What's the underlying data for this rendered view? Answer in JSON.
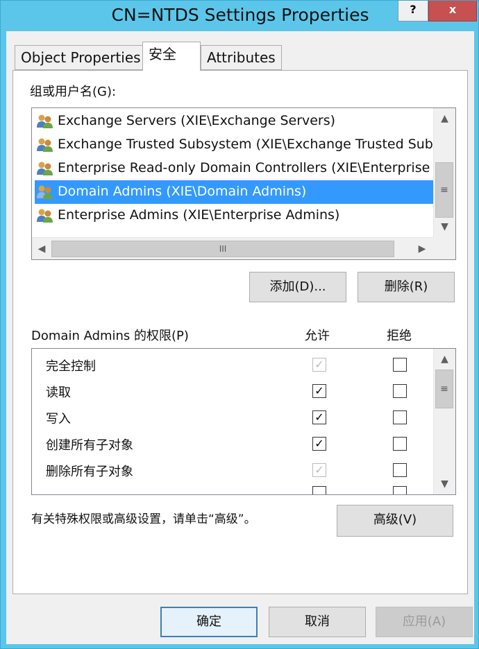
{
  "window": {
    "title": "CN=NTDS Settings Properties",
    "help_label": "?",
    "close_label": "x"
  },
  "tabs": [
    {
      "label": "Object Properties",
      "active": false
    },
    {
      "label": "安全",
      "active": true
    },
    {
      "label": "Attributes",
      "active": false
    }
  ],
  "security": {
    "group_label": "组或用户名(G):",
    "groups": [
      {
        "name": "Exchange Servers (XIE\\Exchange Servers)",
        "selected": false
      },
      {
        "name": "Exchange Trusted Subsystem (XIE\\Exchange Trusted Sub",
        "selected": false
      },
      {
        "name": "Enterprise Read-only Domain Controllers (XIE\\Enterprise",
        "selected": false
      },
      {
        "name": "Domain Admins (XIE\\Domain Admins)",
        "selected": true
      },
      {
        "name": "Enterprise Admins (XIE\\Enterprise Admins)",
        "selected": false
      }
    ],
    "hscroll_grip": "III",
    "vscroll_grip": "≡",
    "add_button": "添加(D)...",
    "remove_button": "删除(R)",
    "perm_label": "Domain Admins 的权限(P)",
    "allow_header": "允许",
    "deny_header": "拒绝",
    "permissions": [
      {
        "name": "完全控制",
        "allow": "inherited",
        "deny": false
      },
      {
        "name": "读取",
        "allow": "checked",
        "deny": false
      },
      {
        "name": "写入",
        "allow": "checked",
        "deny": false
      },
      {
        "name": "创建所有子对象",
        "allow": "checked",
        "deny": false
      },
      {
        "name": "删除所有子对象",
        "allow": "inherited",
        "deny": false
      }
    ],
    "advanced_hint": "有关特殊权限或高级设置，请单击“高级”。",
    "advanced_button": "高级(V)"
  },
  "footer": {
    "ok": "确定",
    "cancel": "取消",
    "apply": "应用(A)"
  },
  "colors": {
    "titlebar": "#5bc6ea",
    "selection": "#3399ff",
    "close": "#c75050"
  }
}
